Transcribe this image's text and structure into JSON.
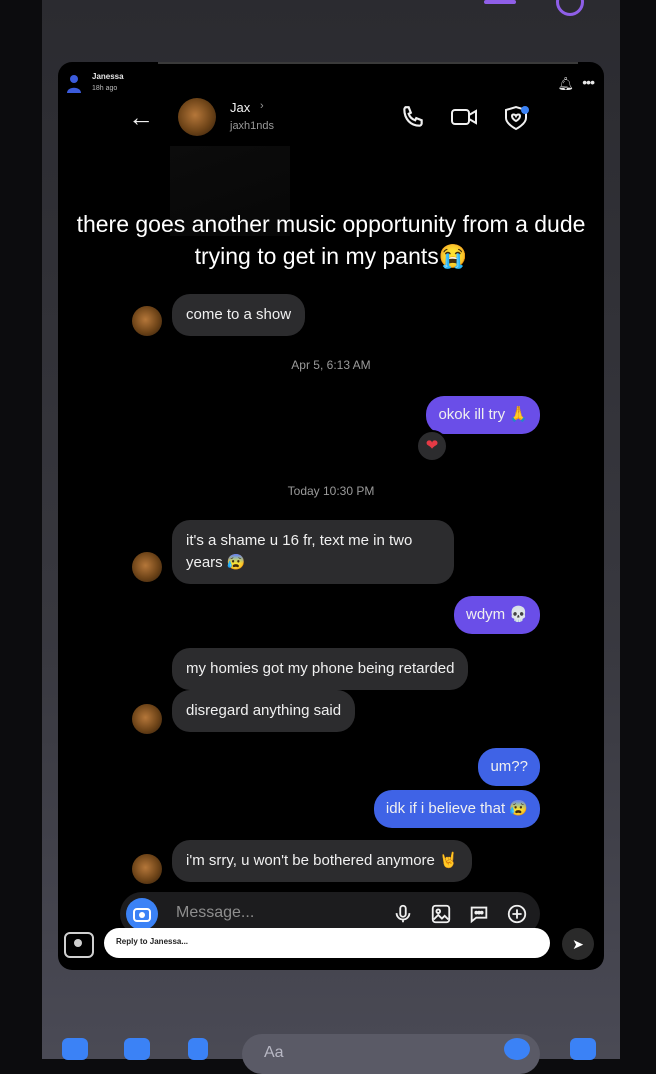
{
  "story": {
    "poster_name": "Janessa",
    "poster_time": "18h ago",
    "caption": "there goes another music opportunity from a dude trying to get in my pants😭"
  },
  "contact": {
    "name": "Jax",
    "handle": "jaxh1nds"
  },
  "messages": [
    {
      "id": "m1",
      "side": "in",
      "text": "come to a show"
    },
    {
      "id": "ts1",
      "type": "timestamp",
      "text": "Apr 5, 6:13 AM"
    },
    {
      "id": "m2",
      "side": "out",
      "text": "okok ill try 🙏",
      "reaction": "❤"
    },
    {
      "id": "ts2",
      "type": "timestamp",
      "text": "Today 10:30 PM"
    },
    {
      "id": "m3",
      "side": "in",
      "text": "it's a shame u 16 fr, text me in two years 😰"
    },
    {
      "id": "m4",
      "side": "out",
      "text": "wdym 💀"
    },
    {
      "id": "m5",
      "side": "in",
      "text": "my homies got my phone being retarded"
    },
    {
      "id": "m6",
      "side": "in",
      "text": "disregard anything said"
    },
    {
      "id": "m7",
      "side": "out",
      "text": "um??"
    },
    {
      "id": "m8",
      "side": "out",
      "text": "idk if i believe that 😰"
    },
    {
      "id": "m9",
      "side": "in",
      "text": "i'm srry, u won't be bothered anymore 🤘"
    }
  ],
  "composer": {
    "placeholder": "Message..."
  },
  "reply": {
    "placeholder": "Reply to Janessa..."
  },
  "bottom_bar": {
    "message_placeholder": "Aa"
  },
  "colors": {
    "outgoing_purple": "#6a4ee8",
    "outgoing_blue": "#3f63e6",
    "incoming": "#2c2c2e",
    "accent": "#3b82f6"
  }
}
